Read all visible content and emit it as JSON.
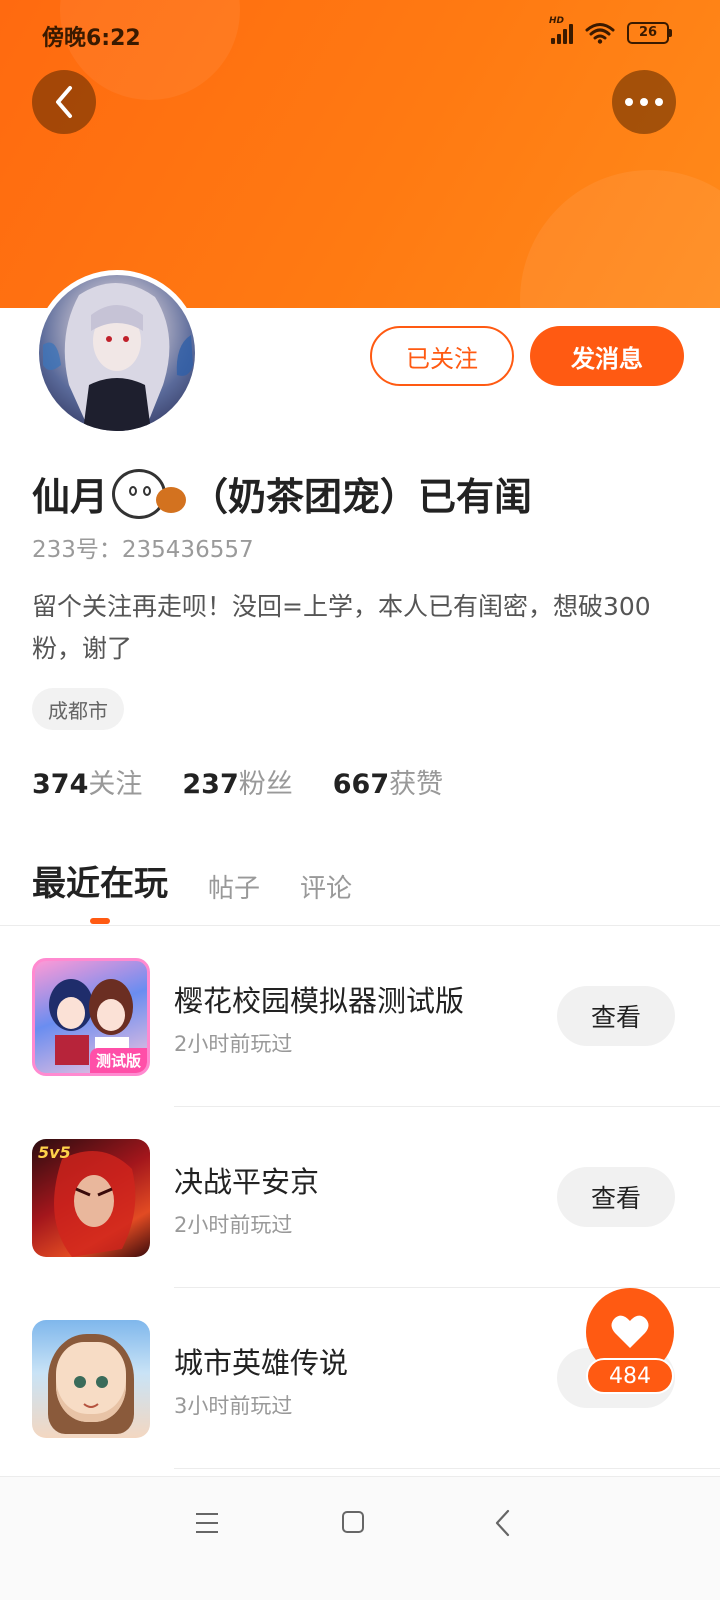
{
  "status_bar": {
    "time": "傍晚6:22",
    "network": "HD",
    "battery": "26",
    "icons": [
      "signal-icon",
      "wifi-icon",
      "battery-icon"
    ]
  },
  "header": {
    "back_icon": "chevron-left-icon",
    "more_icon": "more-horizontal-icon"
  },
  "actions": {
    "follow_label": "已关注",
    "message_label": "发消息"
  },
  "profile": {
    "name_prefix": "仙月",
    "name_suffix": "（奶茶团宠）已有闺",
    "uid": "233号：235436557",
    "bio": "留个关注再走呗！没回=上学，本人已有闺密，想破300粉，谢了",
    "location": "成都市"
  },
  "stats": {
    "following_count": "374",
    "following_label": "关注",
    "followers_count": "237",
    "followers_label": "粉丝",
    "likes_count": "667",
    "likes_label": "获赞"
  },
  "tabs": [
    {
      "label": "最近在玩",
      "active": true
    },
    {
      "label": "帖子",
      "active": false
    },
    {
      "label": "评论",
      "active": false
    }
  ],
  "games": [
    {
      "title": "樱花校园模拟器测试版",
      "time": "2小时前玩过",
      "button": "查看",
      "icon_badge": "测试版"
    },
    {
      "title": "决战平安京",
      "time": "2小时前玩过",
      "button": "查看",
      "icon_badge": "5v5"
    },
    {
      "title": "城市英雄传说",
      "time": "3小时前玩过",
      "button": "查看"
    }
  ],
  "like_fab": {
    "icon": "heart-icon",
    "count": "484"
  },
  "colors": {
    "accent": "#ff5a12",
    "banner": "#ff7a12"
  },
  "nav": {
    "icons": [
      "menu-icon",
      "home-icon",
      "back-icon"
    ]
  }
}
